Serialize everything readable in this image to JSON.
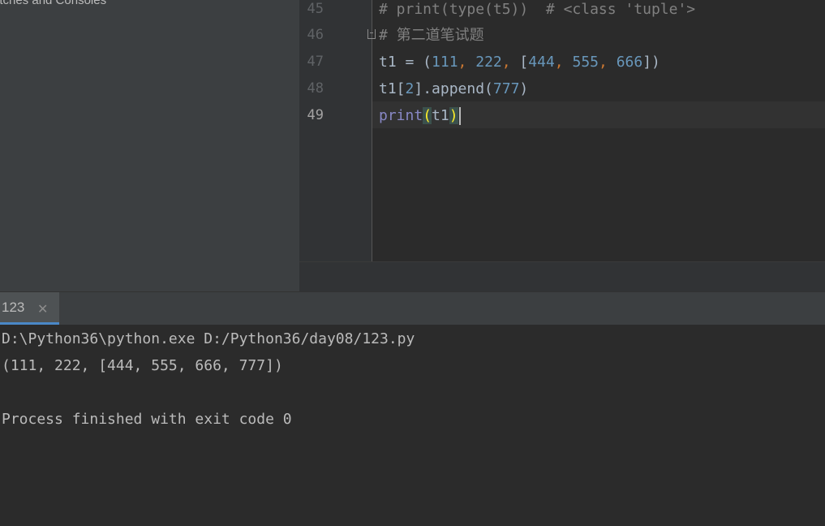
{
  "project_panel": {
    "partial_item": "itches and Consoles"
  },
  "editor": {
    "lines": [
      {
        "number": "45",
        "text": "# print(type(t5))  # <class 'tuple'>"
      },
      {
        "number": "46",
        "text": "# 第二道笔试题"
      },
      {
        "number": "47",
        "text": "t1 = (111, 222, [444, 555, 666])"
      },
      {
        "number": "48",
        "text": "t1[2].append(777)"
      },
      {
        "number": "49",
        "text": "print(t1)"
      }
    ],
    "current_line": "49"
  },
  "run_panel": {
    "tab_label": "123",
    "console_lines": [
      "D:\\Python36\\python.exe D:/Python36/day08/123.py",
      "(111, 222, [444, 555, 666, 777])",
      "",
      "Process finished with exit code 0"
    ]
  },
  "colors": {
    "background": "#2b2b2b",
    "panel": "#3c3f41",
    "comment": "#808080",
    "number": "#6897bb",
    "punctuation": "#cc7832",
    "builtin": "#8888c6",
    "brace_match": "#ffef28"
  }
}
